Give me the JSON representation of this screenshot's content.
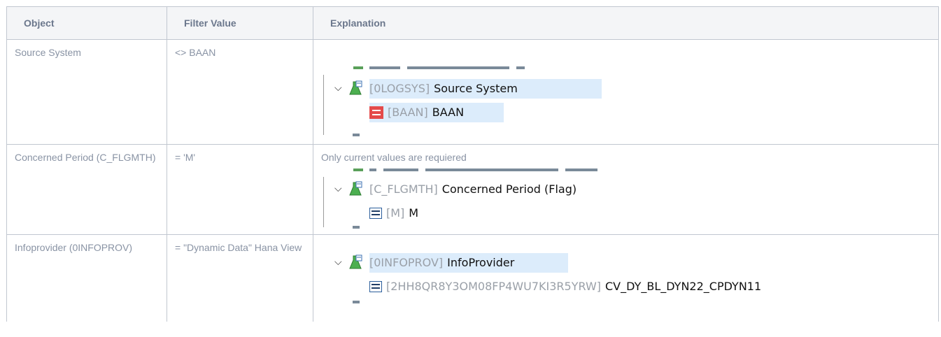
{
  "table": {
    "headers": {
      "object": "Object",
      "filter": "Filter Value",
      "explanation": "Explanation"
    },
    "rows": [
      {
        "object": "Source System",
        "filter": "<> BAAN",
        "note": "",
        "tree": {
          "parent": {
            "tech": "[0LOGSYS]",
            "name": "Source System"
          },
          "child": {
            "tech": "[BAAN]",
            "name": "BAAN",
            "icon": "not-equal-red-icon"
          }
        }
      },
      {
        "object": "Concerned Period (C_FLGMTH)",
        "filter": "= 'M'",
        "note": "Only current values are requiered",
        "tree": {
          "parent": {
            "tech": "[C_FLGMTH]",
            "name": "Concerned Period (Flag)"
          },
          "child": {
            "tech": "[M]",
            "name": "M",
            "icon": "equals-icon"
          }
        }
      },
      {
        "object": "Infoprovider (0INFOPROV)",
        "filter": "= \"Dynamic Data\" Hana View",
        "note": "",
        "tree": {
          "parent": {
            "tech": "[0INFOPROV]",
            "name": "InfoProvider"
          },
          "child": {
            "tech": "[2HH8QR8Y3OM08FP4WU7KI3R5YRW]",
            "name": "CV_DY_BL_DYN22_CPDYN11",
            "icon": "equals-icon"
          }
        }
      }
    ]
  },
  "colors": {
    "header_bg": "#f4f5f7",
    "border": "#c1c7d0",
    "highlight": "#dcecfb",
    "not_equal_icon": "#e44a4a"
  }
}
